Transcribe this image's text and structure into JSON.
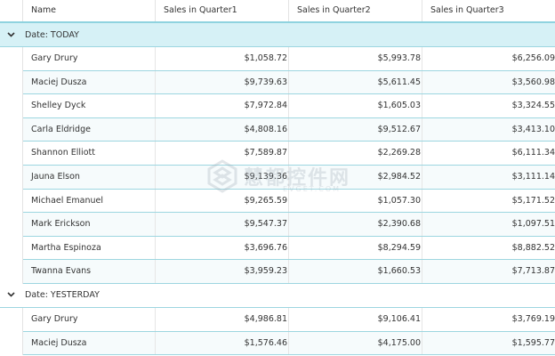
{
  "columns": {
    "name": "Name",
    "q1": "Sales in Quarter1",
    "q2": "Sales in Quarter2",
    "q3": "Sales in Quarter3"
  },
  "groups": [
    {
      "label": "Date: TODAY",
      "rows": [
        {
          "name": "Gary Drury",
          "q1": "$1,058.72",
          "q2": "$5,993.78",
          "q3": "$6,256.09"
        },
        {
          "name": "Maciej Dusza",
          "q1": "$9,739.63",
          "q2": "$5,611.45",
          "q3": "$3,560.98"
        },
        {
          "name": "Shelley Dyck",
          "q1": "$7,972.84",
          "q2": "$1,605.03",
          "q3": "$3,324.55"
        },
        {
          "name": "Carla Eldridge",
          "q1": "$4,808.16",
          "q2": "$9,512.67",
          "q3": "$3,413.10"
        },
        {
          "name": "Shannon Elliott",
          "q1": "$7,589.87",
          "q2": "$2,269.28",
          "q3": "$6,111.34"
        },
        {
          "name": "Jauna Elson",
          "q1": "$9,139.36",
          "q2": "$2,984.52",
          "q3": "$3,111.14"
        },
        {
          "name": "Michael Emanuel",
          "q1": "$9,265.59",
          "q2": "$1,057.30",
          "q3": "$5,171.52"
        },
        {
          "name": "Mark Erickson",
          "q1": "$9,547.37",
          "q2": "$2,390.68",
          "q3": "$1,097.51"
        },
        {
          "name": "Martha Espinoza",
          "q1": "$3,696.76",
          "q2": "$8,294.59",
          "q3": "$8,882.52"
        },
        {
          "name": "Twanna Evans",
          "q1": "$3,959.23",
          "q2": "$1,660.53",
          "q3": "$7,713.87"
        }
      ]
    },
    {
      "label": "Date: YESTERDAY",
      "rows": [
        {
          "name": "Gary Drury",
          "q1": "$4,986.81",
          "q2": "$9,106.41",
          "q3": "$3,769.19"
        },
        {
          "name": "Maciej Dusza",
          "q1": "$1,576.46",
          "q2": "$4,175.00",
          "q3": "$1,595.77"
        }
      ]
    }
  ],
  "watermark": {
    "text": "慧都控件网",
    "sub": "EVGET.COM"
  },
  "colors": {
    "group_header_bg": "#d6f1f6",
    "border_accent": "#8fd3df"
  },
  "icons": {
    "group_toggle": "chevron-down-icon"
  }
}
